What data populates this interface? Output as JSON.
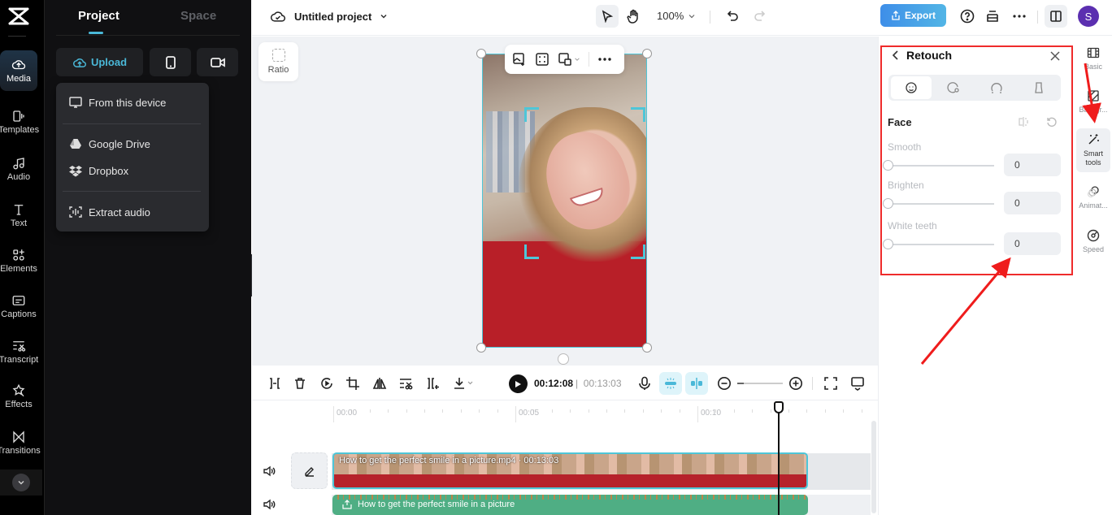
{
  "left_rail": {
    "items": [
      {
        "label": "Media",
        "icon": "cloud-upload-icon",
        "active": true
      },
      {
        "label": "Templates",
        "icon": "templates-icon"
      },
      {
        "label": "Audio",
        "icon": "music-note-icon"
      },
      {
        "label": "Text",
        "icon": "text-icon"
      },
      {
        "label": "Elements",
        "icon": "elements-icon"
      },
      {
        "label": "Captions",
        "icon": "captions-icon"
      },
      {
        "label": "Transcript",
        "icon": "transcript-icon"
      },
      {
        "label": "Effects",
        "icon": "effects-icon"
      },
      {
        "label": "Transitions",
        "icon": "transitions-icon"
      }
    ]
  },
  "media_panel": {
    "tabs": [
      {
        "label": "Project",
        "active": true
      },
      {
        "label": "Space",
        "active": false
      }
    ],
    "upload_label": "Upload",
    "upload_menu": [
      {
        "label": "From this device",
        "icon": "monitor-icon"
      },
      {
        "label": "Google Drive",
        "icon": "google-drive-icon"
      },
      {
        "label": "Dropbox",
        "icon": "dropbox-icon"
      },
      {
        "label": "Extract audio",
        "icon": "extract-audio-icon"
      }
    ]
  },
  "topbar": {
    "project_name": "Untitled project",
    "zoom": "100%",
    "export_label": "Export",
    "avatar_initial": "S",
    "accent_color": "#4ab8d8",
    "avatar_color": "#5b2fb0"
  },
  "canvas": {
    "ratio_label": "Ratio"
  },
  "playback": {
    "current_time": "00:12:08",
    "separator": "|",
    "total_time": "00:13:03"
  },
  "timeline": {
    "ruler_labels": [
      "00:00",
      "00:05",
      "00:10"
    ],
    "video_clip_label": "How to get the perfect smile in a picture.mp4 · 00:13:03",
    "audio_clip_label": "How to get the perfect smile in a picture"
  },
  "retouch": {
    "title": "Retouch",
    "section": "Face",
    "sliders": [
      {
        "label": "Smooth",
        "value": "0"
      },
      {
        "label": "Brighten",
        "value": "0"
      },
      {
        "label": "White teeth",
        "value": "0"
      }
    ],
    "highlight_color": "#ef2b2b"
  },
  "right_strip": {
    "items": [
      {
        "label": "Basic"
      },
      {
        "label": "Backgr..."
      },
      {
        "label": "Smart tools",
        "active": true
      },
      {
        "label": "Animat..."
      },
      {
        "label": "Speed"
      }
    ]
  }
}
